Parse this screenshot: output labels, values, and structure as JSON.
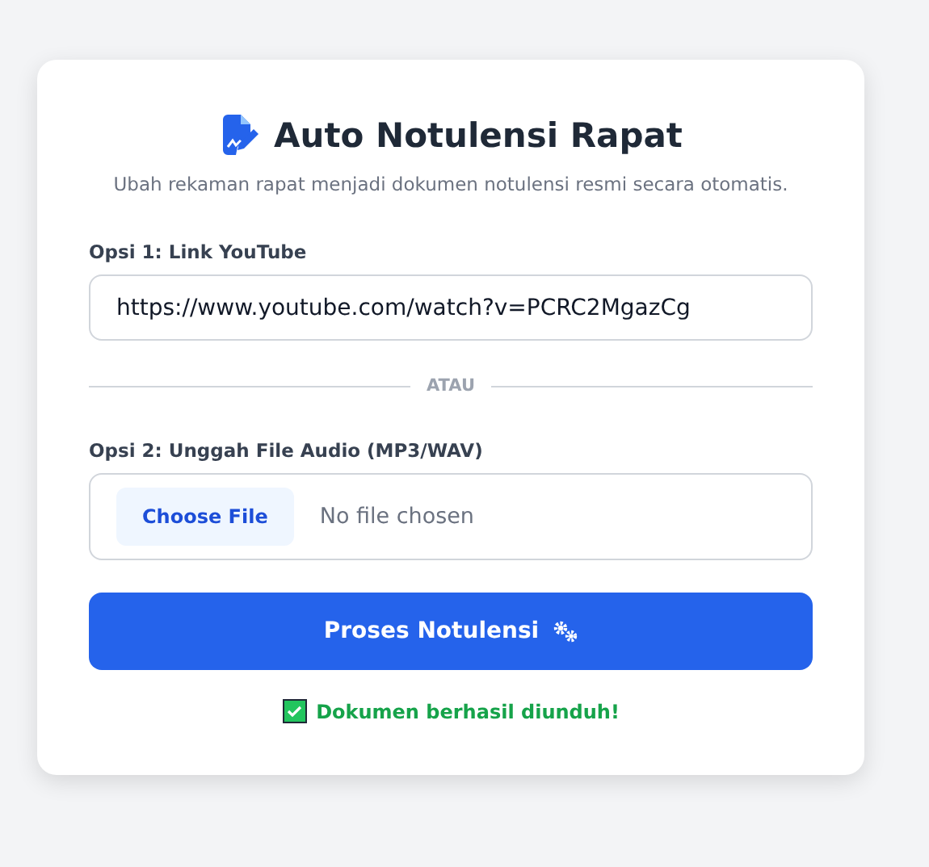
{
  "header": {
    "title": "Auto Notulensi Rapat",
    "subtitle": "Ubah rekaman rapat menjadi dokumen notulensi resmi secara otomatis."
  },
  "youtube": {
    "label": "Opsi 1: Link YouTube",
    "value": "https://www.youtube.com/watch?v=PCRC2MgazCg"
  },
  "divider": {
    "text": "ATAU"
  },
  "upload": {
    "label": "Opsi 2: Unggah File Audio (MP3/WAV)",
    "button": "Choose File",
    "status": "No file chosen"
  },
  "submit": {
    "label": "Proses Notulensi"
  },
  "result": {
    "kind": "success",
    "message": "Dokumen berhasil diunduh!"
  }
}
